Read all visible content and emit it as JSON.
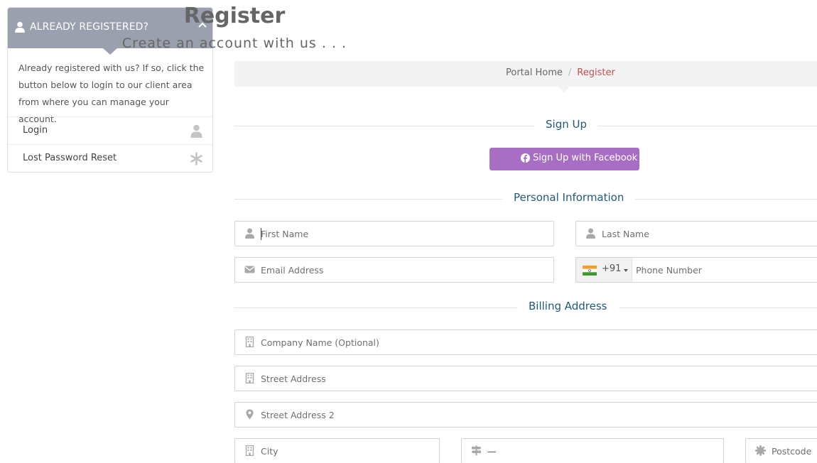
{
  "sidebar": {
    "title": "ALREADY REGISTERED?",
    "text": "Already registered with us? If so, click the button below to login to our client area from where you can manage your account.",
    "items": [
      {
        "label": "Login",
        "icon": "user-icon"
      },
      {
        "label": "Lost Password Reset",
        "icon": "asterisk-icon"
      }
    ]
  },
  "header": {
    "title": "Register",
    "subtitle": "Create an account with us . . ."
  },
  "breadcrumb": {
    "home": "Portal Home",
    "separator": "/",
    "current": "Register"
  },
  "sections": {
    "signup": "Sign Up",
    "personal": "Personal Information",
    "billing": "Billing Address"
  },
  "facebook_button": {
    "label": "Sign Up with Facebook",
    "icon": "facebook-icon",
    "color": "#a76ec3"
  },
  "form": {
    "first_name": {
      "placeholder": "First Name",
      "icon": "user-icon"
    },
    "last_name": {
      "placeholder": "Last Name",
      "icon": "user-icon"
    },
    "email": {
      "placeholder": "Email Address",
      "icon": "envelope-icon"
    },
    "phone": {
      "country_code": "+91",
      "flag": "india-flag",
      "placeholder": "Phone Number"
    },
    "company": {
      "placeholder": "Company Name (Optional)",
      "icon": "building-icon"
    },
    "street": {
      "placeholder": "Street Address",
      "icon": "building-icon"
    },
    "street2": {
      "placeholder": "Street Address 2",
      "icon": "map-marker-icon"
    },
    "city": {
      "placeholder": "City",
      "icon": "building-icon"
    },
    "state": {
      "value": "—",
      "icon": "signpost-icon"
    },
    "postcode": {
      "placeholder": "Postcode",
      "icon": "certificate-icon"
    }
  },
  "colors": {
    "panel_header": "#9aa0ad",
    "section_heading": "#1f5a7a",
    "breadcrumb_current": "#c0504d"
  }
}
